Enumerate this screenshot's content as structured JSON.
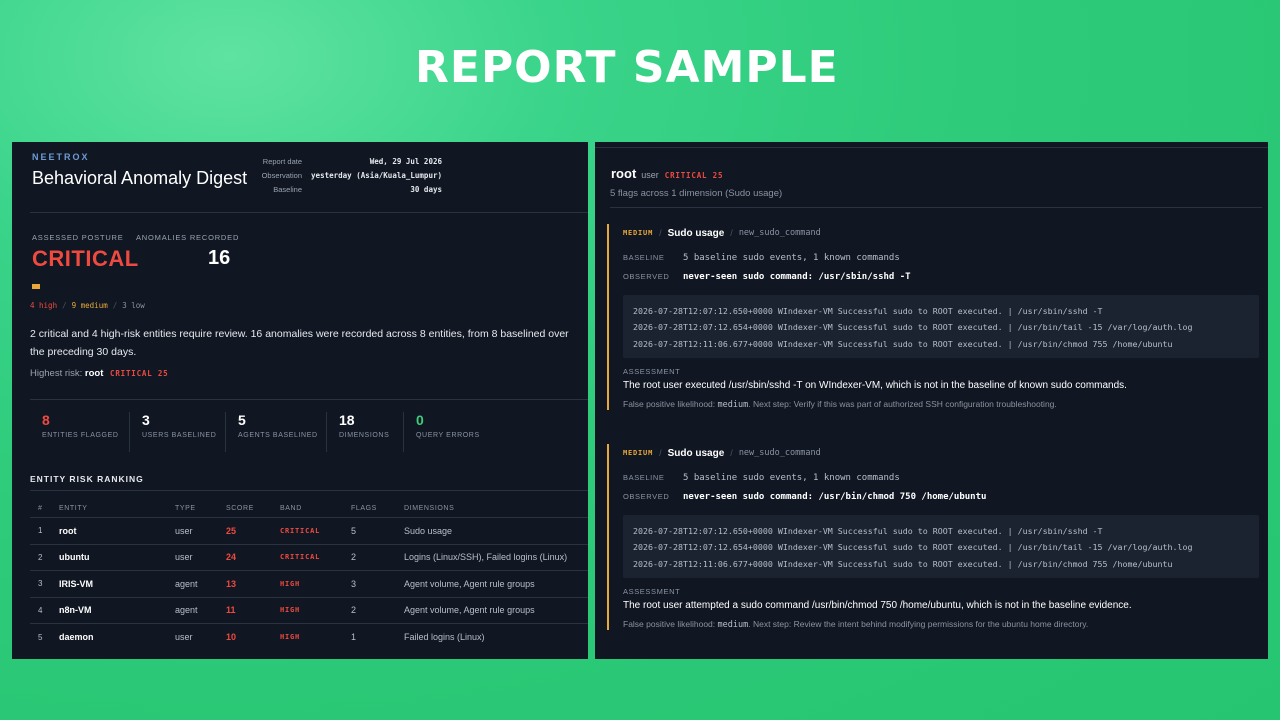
{
  "headline": "REPORT SAMPLE",
  "left": {
    "brand": "NEETROX",
    "title": "Behavioral Anomaly Digest",
    "meta": [
      {
        "label": "Report date",
        "value": "Wed, 29 Jul 2026"
      },
      {
        "label": "Observation",
        "value": "yesterday (Asia/Kuala_Lumpur)"
      },
      {
        "label": "Baseline",
        "value": "30 days"
      }
    ],
    "posture_label": "ASSESSED POSTURE",
    "posture_value": "CRITICAL",
    "anomalies_label": "ANOMALIES RECORDED",
    "anomalies_value": "16",
    "counts": {
      "high": "4 high",
      "medium": "9 medium",
      "low": "3 low"
    },
    "summary": "2 critical and 4 high-risk entities require review. 16 anomalies were recorded across 8 entities, from 8 baselined over the preceding 30 days.",
    "highest": {
      "label": "Highest risk:",
      "entity": "root",
      "badge": "CRITICAL 25"
    },
    "stats": [
      {
        "value": "8",
        "label": "ENTITIES FLAGGED",
        "color": "#ee4a40"
      },
      {
        "value": "3",
        "label": "USERS BASELINED",
        "color": "#ffffff"
      },
      {
        "value": "5",
        "label": "AGENTS BASELINED",
        "color": "#ffffff"
      },
      {
        "value": "18",
        "label": "DIMENSIONS",
        "color": "#ffffff"
      },
      {
        "value": "0",
        "label": "QUERY ERRORS",
        "color": "#3ecb7b"
      }
    ],
    "ranking_title": "ENTITY RISK RANKING",
    "columns": [
      "#",
      "ENTITY",
      "TYPE",
      "SCORE",
      "BAND",
      "FLAGS",
      "DIMENSIONS"
    ],
    "rows": [
      {
        "n": "1",
        "entity": "root",
        "type": "user",
        "score": "25",
        "band": "CRITICAL",
        "flags": "5",
        "dims": "Sudo usage"
      },
      {
        "n": "2",
        "entity": "ubuntu",
        "type": "user",
        "score": "24",
        "band": "CRITICAL",
        "flags": "2",
        "dims": "Logins (Linux/SSH), Failed logins (Linux)"
      },
      {
        "n": "3",
        "entity": "IRIS-VM",
        "type": "agent",
        "score": "13",
        "band": "HIGH",
        "flags": "3",
        "dims": "Agent volume, Agent rule groups"
      },
      {
        "n": "4",
        "entity": "n8n-VM",
        "type": "agent",
        "score": "11",
        "band": "HIGH",
        "flags": "2",
        "dims": "Agent volume, Agent rule groups"
      },
      {
        "n": "5",
        "entity": "daemon",
        "type": "user",
        "score": "10",
        "band": "HIGH",
        "flags": "1",
        "dims": "Failed logins (Linux)"
      }
    ]
  },
  "right": {
    "entity": "root",
    "type": "user",
    "badge": "CRITICAL 25",
    "subtitle": "5 flags across 1 dimension (Sudo usage)",
    "findings": [
      {
        "severity": "MEDIUM",
        "dimension": "Sudo usage",
        "key": "new_sudo_command",
        "baseline_label": "BASELINE",
        "baseline": "5 baseline sudo events, 1 known commands",
        "observed_label": "OBSERVED",
        "observed": "never-seen sudo command: /usr/sbin/sshd -T",
        "logs": [
          "2026-07-28T12:07:12.650+0000 WIndexer-VM Successful sudo to ROOT executed. | /usr/sbin/sshd -T",
          "2026-07-28T12:07:12.654+0000 WIndexer-VM Successful sudo to ROOT executed. | /usr/bin/tail -15 /var/log/auth.log",
          "2026-07-28T12:11:06.677+0000 WIndexer-VM Successful sudo to ROOT executed. | /usr/bin/chmod 755 /home/ubuntu"
        ],
        "assessment_label": "ASSESSMENT",
        "assessment": "The root user executed /usr/sbin/sshd -T on WIndexer-VM, which is not in the baseline of known sudo commands.",
        "fp_prefix": "False positive likelihood:",
        "fp_value": "medium",
        "fp_rest": ". Next step: Verify if this was part of authorized SSH configuration troubleshooting."
      },
      {
        "severity": "MEDIUM",
        "dimension": "Sudo usage",
        "key": "new_sudo_command",
        "baseline_label": "BASELINE",
        "baseline": "5 baseline sudo events, 1 known commands",
        "observed_label": "OBSERVED",
        "observed": "never-seen sudo command: /usr/bin/chmod 750 /home/ubuntu",
        "logs": [
          "2026-07-28T12:07:12.650+0000 WIndexer-VM Successful sudo to ROOT executed. | /usr/sbin/sshd -T",
          "2026-07-28T12:07:12.654+0000 WIndexer-VM Successful sudo to ROOT executed. | /usr/bin/tail -15 /var/log/auth.log",
          "2026-07-28T12:11:06.677+0000 WIndexer-VM Successful sudo to ROOT executed. | /usr/bin/chmod 755 /home/ubuntu"
        ],
        "assessment_label": "ASSESSMENT",
        "assessment": "The root user attempted a sudo command /usr/bin/chmod 750 /home/ubuntu, which is not in the baseline evidence.",
        "fp_prefix": "False positive likelihood:",
        "fp_value": "medium",
        "fp_rest": ". Next step: Review the intent behind modifying permissions for the ubuntu home directory."
      }
    ]
  }
}
